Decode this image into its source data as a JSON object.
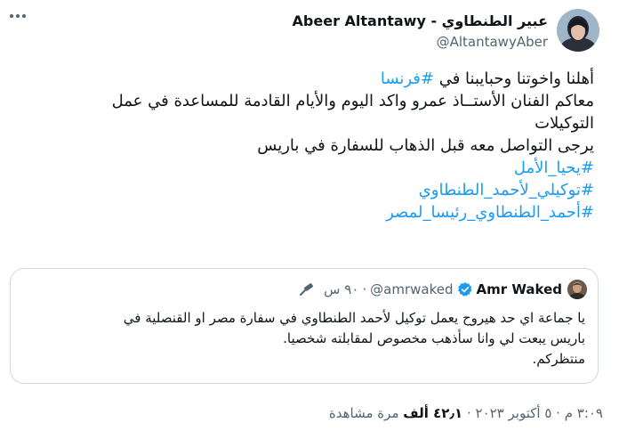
{
  "author": {
    "display_name": "Abeer Altantawy - عبير الطنطاوي",
    "handle": "@AltantawyAber"
  },
  "tweet": {
    "line1_text": "أهلنا واخوتنا وحبايبنا في ",
    "line1_hashtag": "#فرنسا",
    "line2": "معاكم الفنان الأستــاذ عمرو واكد اليوم والأيام القادمة للمساعدة في عمل",
    "line3": "التوكيلات",
    "line4": "يرجى التواصل معه قبل الذهاب للسفارة في باريس",
    "hashtags": [
      "#يحيا_الأمل",
      "#توكيلي_لأحمد_الطنطاوي",
      "#أحمد_الطنطاوي_رئيسا_لمصر"
    ]
  },
  "quoted": {
    "name": "Amr Waked",
    "handle": "@amrwaked",
    "separator": "·",
    "time": "٩٠ س",
    "lines": [
      "يا جماعة اي حد هيروح يعمل توكيل لأحمد الطنطاوي في سفارة مصر او القنصلية في",
      "باريس يبعت لي وانا سأذهب مخصوص لمقابلته شخصيا.",
      "منتظركم."
    ]
  },
  "meta": {
    "time": "٣:٠٩ م",
    "sep1": " · ",
    "date": "٥ أكتوبر ٢٠٢٣",
    "sep2": " · ",
    "views_count": "٤٢٫١ ألف",
    "views_label": " مرة مشاهدة"
  },
  "colors": {
    "accent": "#1d9bf0",
    "secondary_text": "#536471",
    "border": "#cfd9de"
  },
  "icons": [
    "more-icon",
    "verified-badge-icon",
    "pin-icon"
  ]
}
